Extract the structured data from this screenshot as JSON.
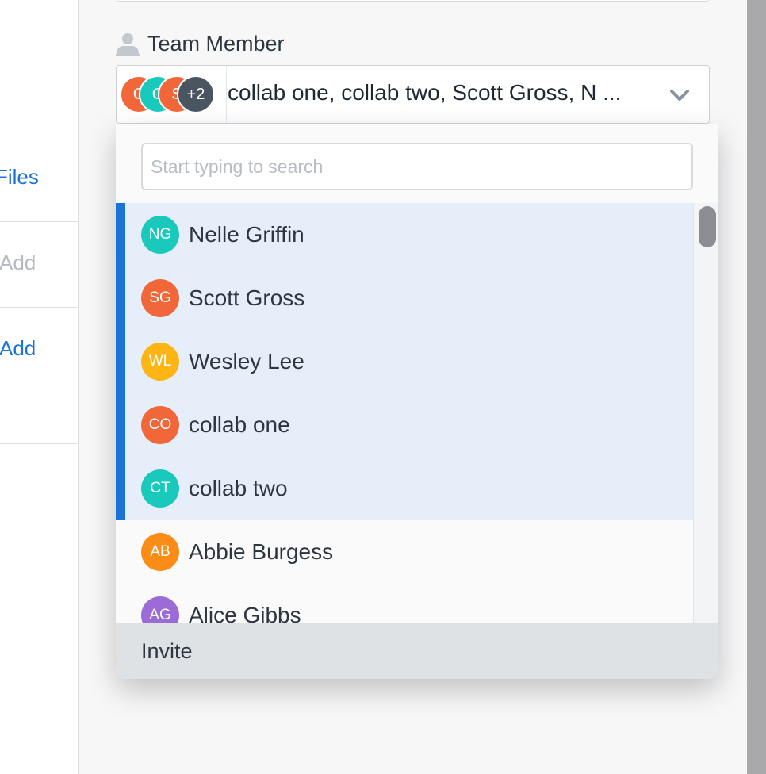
{
  "left_panel": {
    "items": [
      {
        "label": "Files",
        "style": "link"
      },
      {
        "label": "Add",
        "style": "muted"
      },
      {
        "label": "Add",
        "style": "link"
      }
    ]
  },
  "field": {
    "label": "Team Member",
    "icon": "person-icon",
    "selected_text": "collab one, collab two, Scott Gross, N ...",
    "avatar_stack": [
      {
        "initials": "C",
        "color": "#f2673a"
      },
      {
        "initials": "C",
        "color": "#19c9bb"
      },
      {
        "initials": "S",
        "color": "#f2673a"
      }
    ],
    "overflow_badge": "+2",
    "overflow_color": "#4b5561",
    "chevron_icon": "chevron-down-icon"
  },
  "dropdown": {
    "search_placeholder": "Start typing to search",
    "search_value": "",
    "accent_color": "#1a73d9",
    "selected_bg": "#e5eef9",
    "options": [
      {
        "initials": "NG",
        "name": "Nelle Griffin",
        "color": "#19c9bb",
        "selected": true
      },
      {
        "initials": "SG",
        "name": "Scott Gross",
        "color": "#f2673a",
        "selected": true
      },
      {
        "initials": "WL",
        "name": "Wesley Lee",
        "color": "#fdb515",
        "selected": true
      },
      {
        "initials": "CO",
        "name": "collab one",
        "color": "#f2673a",
        "selected": true
      },
      {
        "initials": "CT",
        "name": "collab two",
        "color": "#19c9bb",
        "selected": true
      },
      {
        "initials": "AB",
        "name": "Abbie Burgess",
        "color": "#fb8c15",
        "selected": false
      },
      {
        "initials": "AG",
        "name": "Alice Gibbs",
        "color": "#9b6bd6",
        "selected": false
      }
    ],
    "footer_label": "Invite"
  }
}
